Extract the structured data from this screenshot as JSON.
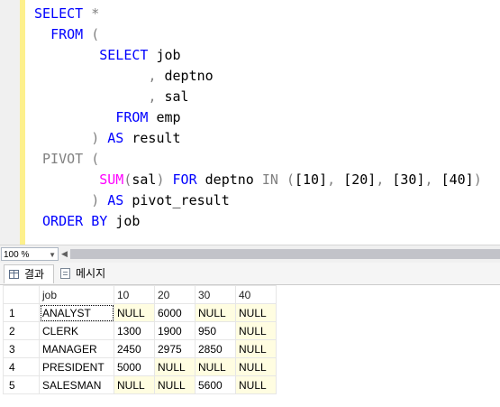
{
  "editor": {
    "lines": [
      [
        {
          "t": "SELECT ",
          "c": "kw"
        },
        {
          "t": "*",
          "c": "op"
        }
      ],
      [
        {
          "t": "  "
        },
        {
          "t": "FROM ",
          "c": "kw"
        },
        {
          "t": "(",
          "c": "op"
        }
      ],
      [
        {
          "t": "        "
        },
        {
          "t": "SELECT ",
          "c": "kw"
        },
        {
          "t": "job"
        }
      ],
      [
        {
          "t": "              "
        },
        {
          "t": ", ",
          "c": "op"
        },
        {
          "t": "deptno"
        }
      ],
      [
        {
          "t": "              "
        },
        {
          "t": ", ",
          "c": "op"
        },
        {
          "t": "sal"
        }
      ],
      [
        {
          "t": "          "
        },
        {
          "t": "FROM ",
          "c": "kw"
        },
        {
          "t": "emp"
        }
      ],
      [
        {
          "t": "       "
        },
        {
          "t": ") ",
          "c": "op"
        },
        {
          "t": "AS ",
          "c": "kw"
        },
        {
          "t": "result"
        }
      ],
      [
        {
          "t": " "
        },
        {
          "t": "PIVOT ",
          "c": "gr"
        },
        {
          "t": "(",
          "c": "op"
        }
      ],
      [
        {
          "t": "        "
        },
        {
          "t": "SUM",
          "c": "fn"
        },
        {
          "t": "(",
          "c": "op"
        },
        {
          "t": "sal"
        },
        {
          "t": ") ",
          "c": "op"
        },
        {
          "t": "FOR ",
          "c": "kw"
        },
        {
          "t": "deptno "
        },
        {
          "t": "IN ",
          "c": "gr"
        },
        {
          "t": "(",
          "c": "op"
        },
        {
          "t": "[10]"
        },
        {
          "t": ", ",
          "c": "op"
        },
        {
          "t": "[20]"
        },
        {
          "t": ", ",
          "c": "op"
        },
        {
          "t": "[30]"
        },
        {
          "t": ", ",
          "c": "op"
        },
        {
          "t": "[40]"
        },
        {
          "t": ")",
          "c": "op"
        }
      ],
      [
        {
          "t": "       "
        },
        {
          "t": ") ",
          "c": "op"
        },
        {
          "t": "AS ",
          "c": "kw"
        },
        {
          "t": "pivot_result"
        }
      ],
      [
        {
          "t": " "
        },
        {
          "t": "ORDER BY ",
          "c": "kw"
        },
        {
          "t": "job"
        }
      ]
    ]
  },
  "zoom": {
    "value": "100 %"
  },
  "tabs": {
    "results": "결과",
    "messages": "메시지"
  },
  "grid": {
    "columns": [
      "job",
      "10",
      "20",
      "30",
      "40"
    ],
    "rows": [
      {
        "num": "1",
        "cells": [
          "ANALYST",
          "NULL",
          "6000",
          "NULL",
          "NULL"
        ]
      },
      {
        "num": "2",
        "cells": [
          "CLERK",
          "1300",
          "1900",
          "950",
          "NULL"
        ]
      },
      {
        "num": "3",
        "cells": [
          "MANAGER",
          "2450",
          "2975",
          "2850",
          "NULL"
        ]
      },
      {
        "num": "4",
        "cells": [
          "PRESIDENT",
          "5000",
          "NULL",
          "NULL",
          "NULL"
        ]
      },
      {
        "num": "5",
        "cells": [
          "SALESMAN",
          "NULL",
          "NULL",
          "5600",
          "NULL"
        ]
      }
    ]
  },
  "colors": {
    "keyword": "#0000ff",
    "function": "#ff00ff",
    "operator": "#808080",
    "null_cell": "#fffde1"
  }
}
